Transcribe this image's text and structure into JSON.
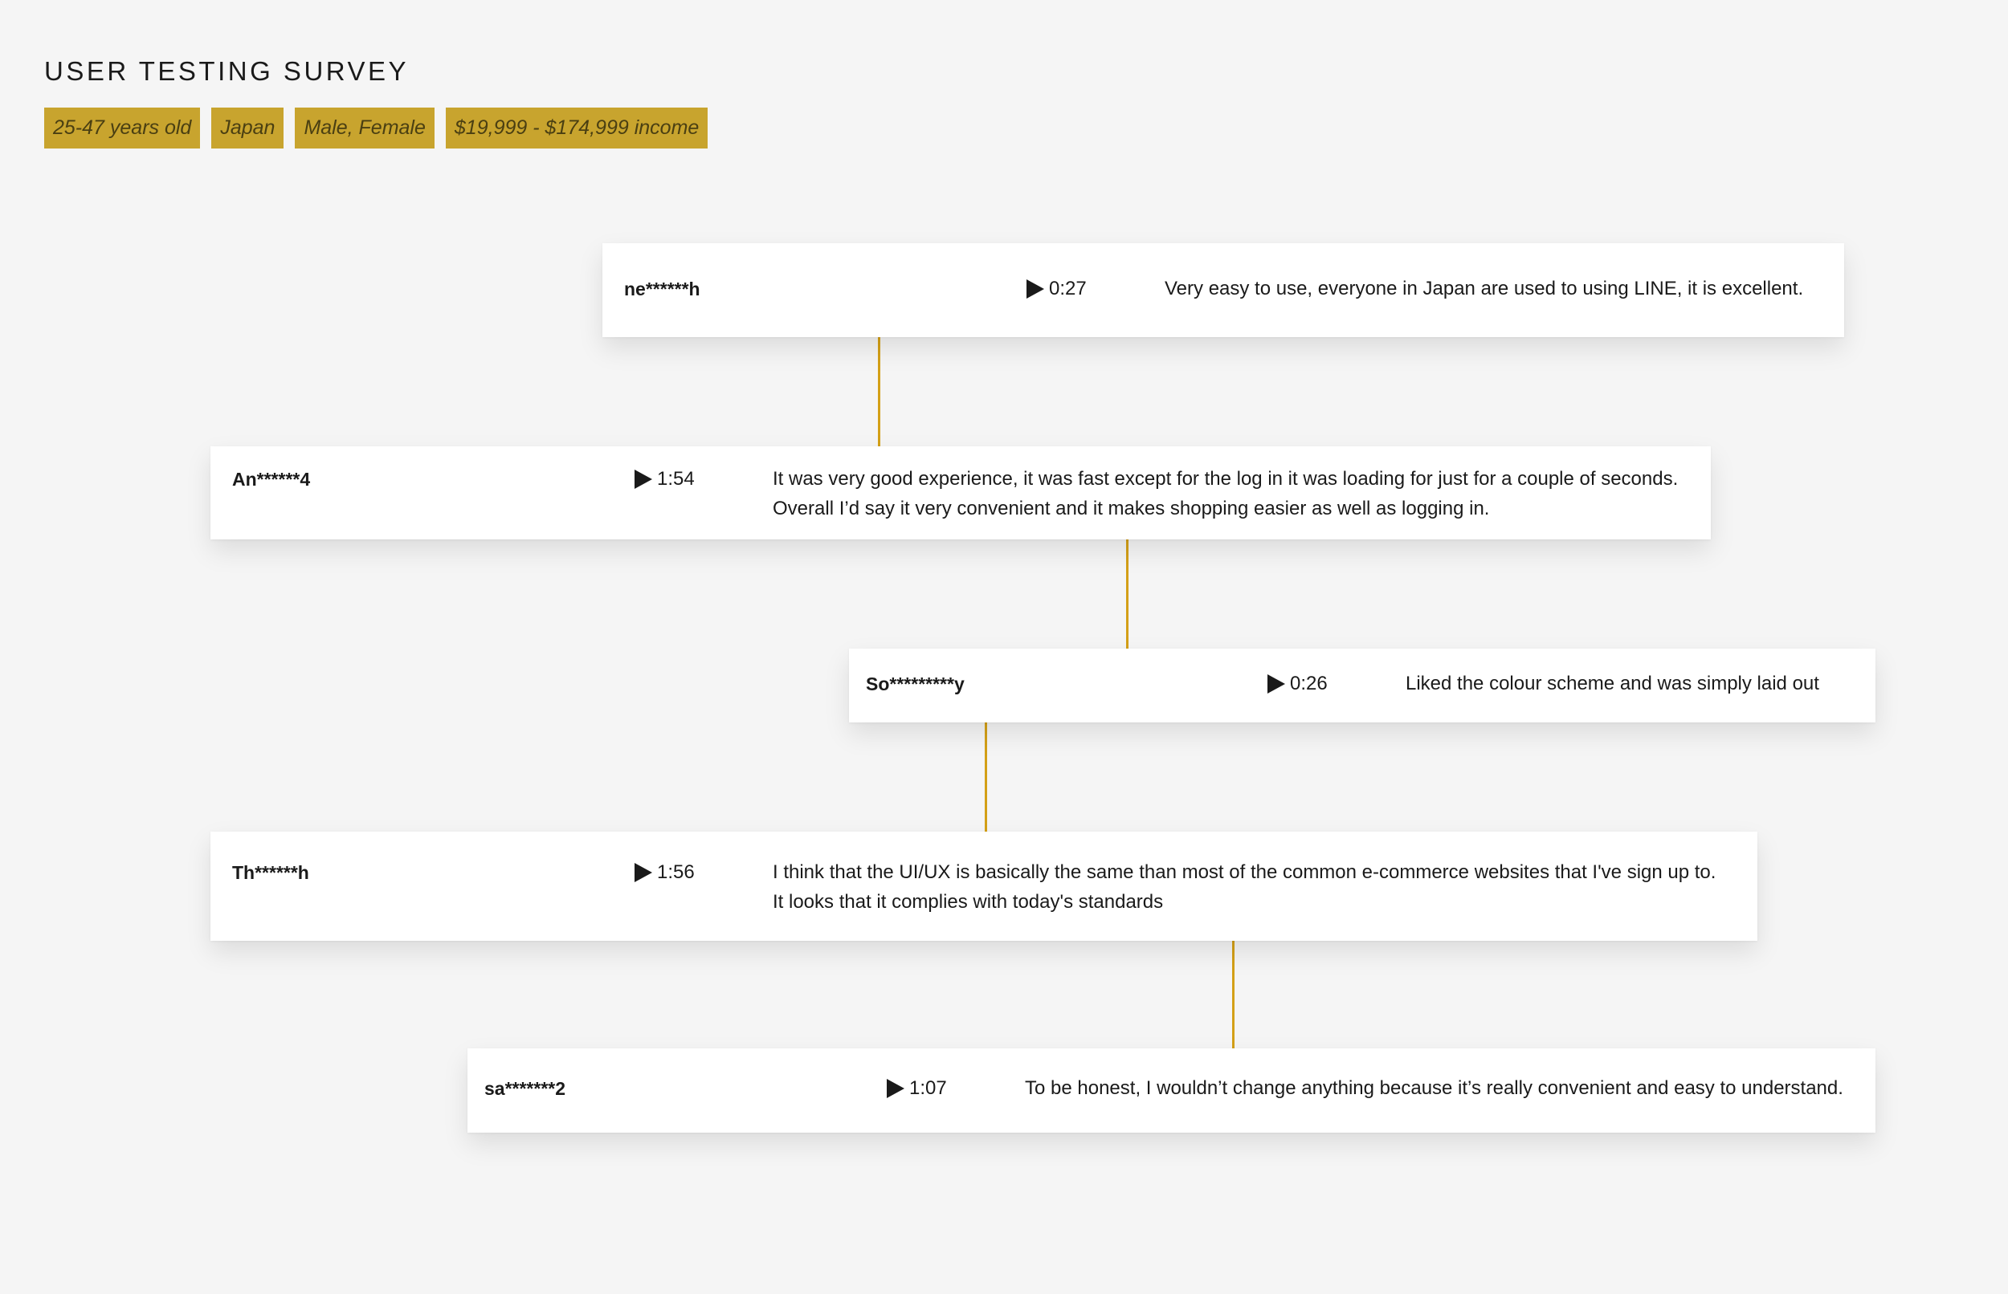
{
  "header": {
    "title": "USER TESTING SURVEY",
    "tags": [
      "25-47 years old",
      "Japan",
      "Male, Female",
      "$19,999 - $174,999 income"
    ]
  },
  "colors": {
    "tag_background": "#c8a42e",
    "connector": "#d4a017",
    "background": "#f5f5f5",
    "card": "#ffffff"
  },
  "responses": [
    {
      "user": "ne******h",
      "duration": "0:27",
      "comment_lines": [
        "Very easy to use, everyone in Japan are used to using LINE, it is excellent."
      ]
    },
    {
      "user": "An******4",
      "duration": "1:54",
      "comment_lines": [
        "It was very good experience, it was fast except for the log in it was loading for just for a couple of seconds.",
        "Overall I’d say it very convenient and it makes shopping easier as well as logging in."
      ]
    },
    {
      "user": "So*********y",
      "duration": "0:26",
      "comment_lines": [
        "Liked the colour scheme and was simply laid out"
      ]
    },
    {
      "user": "Th******h",
      "duration": "1:56",
      "comment_lines": [
        "I think that the UI/UX is basically the same than most of the common e-commerce websites that I've sign up to.",
        "It looks that it complies with today's standards"
      ]
    },
    {
      "user": "sa*******2",
      "duration": "1:07",
      "comment_lines": [
        "To be honest, I wouldn’t change anything because it’s really convenient and easy to understand."
      ]
    }
  ],
  "icons": {
    "play": "play-icon"
  }
}
